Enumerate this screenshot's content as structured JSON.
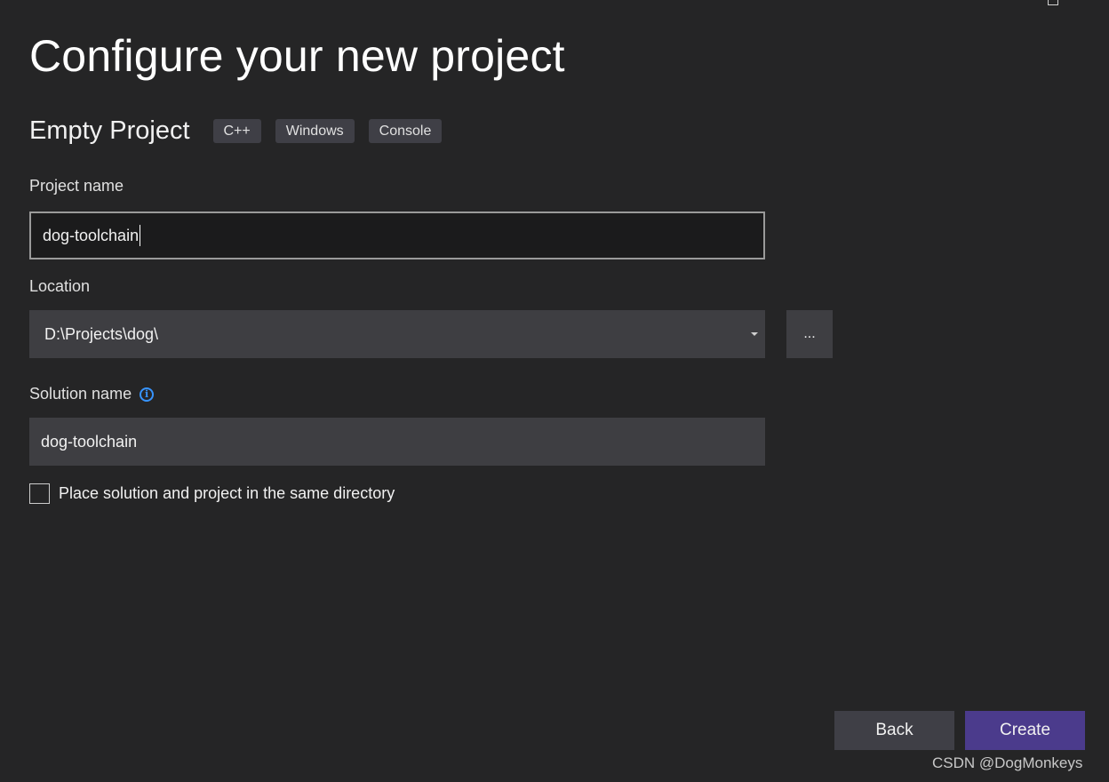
{
  "header": {
    "title": "Configure your new project"
  },
  "template": {
    "name": "Empty Project",
    "tags": [
      "C++",
      "Windows",
      "Console"
    ]
  },
  "project_name": {
    "label": "Project name",
    "value": "dog-toolchain"
  },
  "location": {
    "label": "Location",
    "value": "D:\\Projects\\dog\\",
    "browse_label": "..."
  },
  "solution_name": {
    "label": "Solution name",
    "value": "dog-toolchain"
  },
  "same_directory": {
    "label": "Place solution and project in the same directory",
    "checked": false
  },
  "buttons": {
    "back": "Back",
    "create": "Create"
  },
  "watermark": "CSDN @DogMonkeys",
  "colors": {
    "background": "#252526",
    "accent": "#4b3b8c",
    "info": "#3794ff"
  }
}
